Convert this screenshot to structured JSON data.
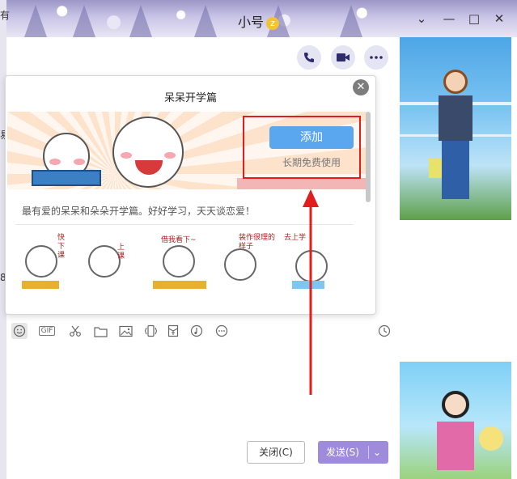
{
  "window": {
    "title": "小号",
    "title_badge": "z",
    "minimize": "—",
    "maximize": "□",
    "close": "✕",
    "dropdown": "⌄"
  },
  "left_edge": {
    "chars": [
      "有",
      "易",
      "8"
    ]
  },
  "call": {
    "icons": [
      "phone-icon",
      "video-icon",
      "more-icon"
    ]
  },
  "popup": {
    "title": "呆呆开学篇",
    "close": "✕",
    "add_label": "添加",
    "free_label": "长期免费使用",
    "description": "最有爱的呆呆和朵朵开学篇。好好学习，天天谈恋爱！",
    "stickers": [
      {
        "text": "快下课"
      },
      {
        "text": "上课"
      },
      {
        "text": "借我看下~"
      },
      {
        "text": "装作很理的样子"
      },
      {
        "text": "去上学"
      }
    ]
  },
  "toolbar": {
    "icons": [
      "emoji-icon",
      "gif-icon",
      "scissors-icon",
      "folder-icon",
      "image-icon",
      "shake-icon",
      "red-packet-icon",
      "music-icon",
      "more-icon"
    ],
    "gif_label": "GIF",
    "history_icon": "clock-icon"
  },
  "buttons": {
    "close_label": "关闭(C)",
    "send_label": "发送(S)",
    "send_arrow": "⌄"
  },
  "colors": {
    "accent": "#9f8bdc",
    "add_button": "#5aa7ef",
    "highlight": "#e11d1d"
  }
}
